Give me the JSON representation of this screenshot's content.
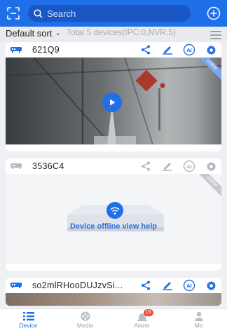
{
  "header": {
    "search_placeholder": "Search"
  },
  "sortbar": {
    "sort_label": "Default sort",
    "total_text": "Total 5 devices(IPC:0,NVR:5)"
  },
  "devices": [
    {
      "name": "621Q9",
      "status": "online",
      "ai_label": "AI"
    },
    {
      "name": "3536C4",
      "status": "online",
      "ai_label": "AI",
      "offline_help": "Device offline view help"
    },
    {
      "name": "so2mlRHooDUJzvSi...",
      "ai_label": "AI"
    }
  ],
  "tabs": [
    {
      "label": "Device",
      "active": true
    },
    {
      "label": "Media",
      "active": false
    },
    {
      "label": "Alarm",
      "active": false,
      "badge": "16"
    },
    {
      "label": "Me",
      "active": false
    }
  ],
  "colors": {
    "brand": "#1e6fe8",
    "alarm_badge": "#ef4a3d"
  }
}
